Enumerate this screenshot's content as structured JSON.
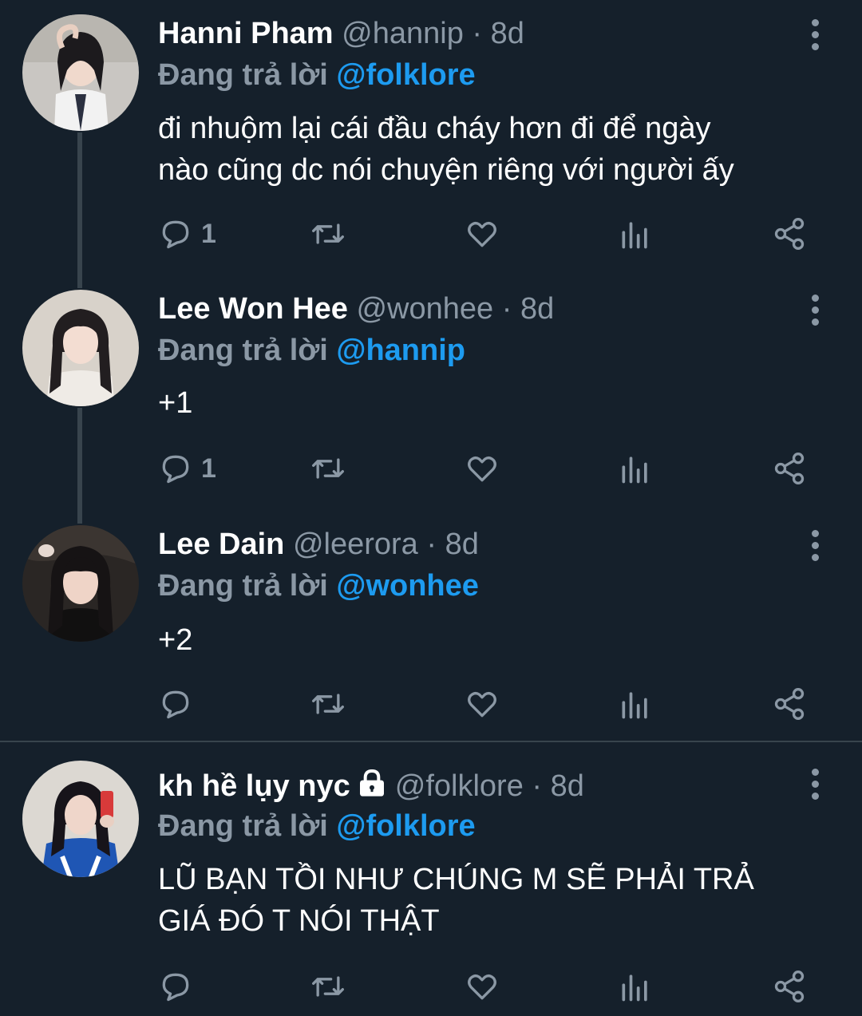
{
  "tweets": [
    {
      "name": "Hanni Pham",
      "handle": "@hannip",
      "time": "· 8d",
      "reply_label": "Đang trả lời",
      "reply_to": "@folklore",
      "text_lines": [
        "đi nhuộm lại cái đầu cháy hơn đi để ngày",
        "nào cũng dc nói chuyện riêng với người ấy"
      ],
      "reply_count": "1",
      "locked": false
    },
    {
      "name": "Lee Won Hee",
      "handle": "@wonhee",
      "time": "· 8d",
      "reply_label": "Đang trả lời",
      "reply_to": "@hannip",
      "text_lines": [
        "+1"
      ],
      "reply_count": "1",
      "locked": false
    },
    {
      "name": "Lee Dain",
      "handle": "@leerora",
      "time": "· 8d",
      "reply_label": "Đang trả lời",
      "reply_to": "@wonhee",
      "text_lines": [
        "+2"
      ],
      "reply_count": "",
      "locked": false
    },
    {
      "name": "kh hề lụy nyc",
      "handle": "@folklore",
      "time": "· 8d",
      "reply_label": "Đang trả lời",
      "reply_to": "@folklore",
      "text_lines": [
        "LŨ BẠN TỒI NHƯ CHÚNG M SẼ PHẢI TRẢ",
        "GIÁ ĐÓ T NÓI THẬT"
      ],
      "reply_count": "",
      "locked": true
    }
  ],
  "icons": {
    "reply": "reply-icon",
    "retweet": "retweet-icon",
    "like": "heart-icon",
    "views": "analytics-icon",
    "share": "share-icon",
    "more": "more-vertical-icon",
    "lock": "lock-icon"
  },
  "colors": {
    "background": "#15202b",
    "text": "#ffffff",
    "secondary": "#8b98a5",
    "accent": "#1d9bf0",
    "line": "#38444d"
  }
}
